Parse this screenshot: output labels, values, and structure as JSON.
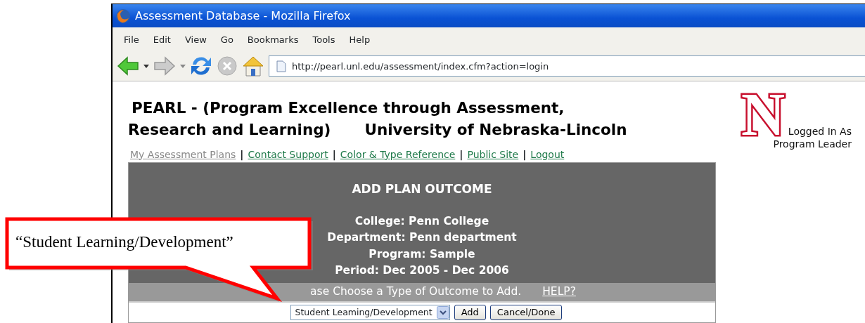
{
  "window": {
    "title": "Assessment Database - Mozilla Firefox"
  },
  "menu": [
    "File",
    "Edit",
    "View",
    "Go",
    "Bookmarks",
    "Tools",
    "Help"
  ],
  "address_bar": {
    "value": "http://pearl.unl.edu/assessment/index.cfm?action=login"
  },
  "page": {
    "title_lines": [
      "PEARL - (Program Excellence through Assessment,",
      "Research and Learning)"
    ],
    "university": "University of Nebraska-Lincoln",
    "logo": {
      "letter": "N"
    },
    "login": [
      "Logged In As",
      "Program Leader"
    ],
    "nav": [
      {
        "label": "My Assessment Plans",
        "selected": true
      },
      {
        "label": "Contact Support",
        "selected": false
      },
      {
        "label": "Color & Type Reference",
        "selected": false
      },
      {
        "label": "Public Site",
        "selected": false
      },
      {
        "label": "Logout",
        "selected": false
      }
    ],
    "separators": [
      "|",
      "|",
      "|",
      "|"
    ],
    "panel": {
      "heading": "ADD PLAN OUTCOME",
      "details": [
        "College: Penn College",
        "Department: Penn department",
        "Program: Sample",
        "Period: Dec 2005 - Dec 2006"
      ],
      "prompt": "ase Choose a Type of Outcome to Add.",
      "help": "HELP?",
      "select": {
        "value": "Student Leaming/Development"
      },
      "buttons": [
        "Add",
        "Cancel/Done"
      ]
    }
  },
  "callout": {
    "text": "“Student Learning/Development”"
  }
}
